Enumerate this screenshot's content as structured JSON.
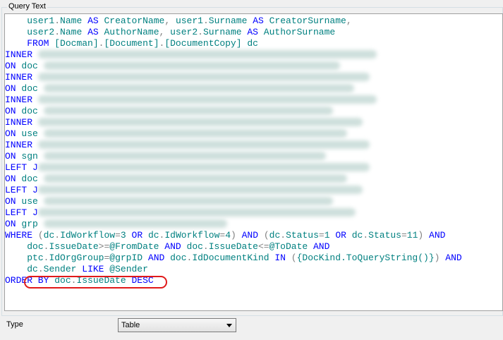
{
  "group_title": "Query Text",
  "type_label": "Type",
  "type_select": {
    "value": "Table"
  },
  "code_lines": [
    [
      {
        "t": "    "
      },
      {
        "t": "user1",
        "c": "id"
      },
      {
        "t": ".",
        "c": "op"
      },
      {
        "t": "Name",
        "c": "id"
      },
      {
        "t": " "
      },
      {
        "t": "AS",
        "c": "kw"
      },
      {
        "t": " "
      },
      {
        "t": "CreatorName",
        "c": "id"
      },
      {
        "t": ", ",
        "c": "op"
      },
      {
        "t": "user1",
        "c": "id"
      },
      {
        "t": ".",
        "c": "op"
      },
      {
        "t": "Surname",
        "c": "id"
      },
      {
        "t": " "
      },
      {
        "t": "AS",
        "c": "kw"
      },
      {
        "t": " "
      },
      {
        "t": "CreatorSurname",
        "c": "id"
      },
      {
        "t": ",",
        "c": "op"
      }
    ],
    [
      {
        "t": "    "
      },
      {
        "t": "user2",
        "c": "id"
      },
      {
        "t": ".",
        "c": "op"
      },
      {
        "t": "Name",
        "c": "id"
      },
      {
        "t": " "
      },
      {
        "t": "AS",
        "c": "kw"
      },
      {
        "t": " "
      },
      {
        "t": "AuthorName",
        "c": "id"
      },
      {
        "t": ", ",
        "c": "op"
      },
      {
        "t": "user2",
        "c": "id"
      },
      {
        "t": ".",
        "c": "op"
      },
      {
        "t": "Surname",
        "c": "id"
      },
      {
        "t": " "
      },
      {
        "t": "AS",
        "c": "kw"
      },
      {
        "t": " "
      },
      {
        "t": "AuthorSurname",
        "c": "id"
      }
    ],
    [
      {
        "t": "    "
      },
      {
        "t": "FROM",
        "c": "kw"
      },
      {
        "t": " "
      },
      {
        "t": "[Docman]",
        "c": "id"
      },
      {
        "t": ".",
        "c": "op"
      },
      {
        "t": "[Document]",
        "c": "id"
      },
      {
        "t": ".",
        "c": "op"
      },
      {
        "t": "[DocumentCopy]",
        "c": "id"
      },
      {
        "t": " "
      },
      {
        "t": "dc",
        "c": "id"
      }
    ],
    [
      {
        "t": "INNER",
        "c": "kw"
      },
      {
        "t": " "
      },
      {
        "blur": 480
      }
    ],
    [
      {
        "t": "ON",
        "c": "kw"
      },
      {
        "t": " "
      },
      {
        "t": "doc",
        "c": "id"
      },
      {
        "t": " "
      },
      {
        "blur": 420
      }
    ],
    [
      {
        "t": "INNER",
        "c": "kw"
      },
      {
        "t": " "
      },
      {
        "blur": 470
      }
    ],
    [
      {
        "t": "ON",
        "c": "kw"
      },
      {
        "t": " "
      },
      {
        "t": "doc",
        "c": "id"
      },
      {
        "t": " "
      },
      {
        "blur": 440
      }
    ],
    [
      {
        "t": "INNER",
        "c": "kw"
      },
      {
        "t": " "
      },
      {
        "blur": 480
      }
    ],
    [
      {
        "t": "ON",
        "c": "kw"
      },
      {
        "t": " "
      },
      {
        "t": "doc",
        "c": "id"
      },
      {
        "t": " "
      },
      {
        "blur": 410
      }
    ],
    [
      {
        "t": "INNER",
        "c": "kw"
      },
      {
        "t": " "
      },
      {
        "blur": 460
      }
    ],
    [
      {
        "t": "ON",
        "c": "kw"
      },
      {
        "t": " "
      },
      {
        "t": "use",
        "c": "id"
      },
      {
        "t": " "
      },
      {
        "blur": 430
      }
    ],
    [
      {
        "t": "INNER",
        "c": "kw"
      },
      {
        "t": " "
      },
      {
        "blur": 470
      }
    ],
    [
      {
        "t": "ON",
        "c": "kw"
      },
      {
        "t": " "
      },
      {
        "t": "sgn",
        "c": "id"
      },
      {
        "t": " "
      },
      {
        "blur": 400
      }
    ],
    [
      {
        "t": "LEFT J",
        "c": "kw"
      },
      {
        "blur": 470
      }
    ],
    [
      {
        "t": "ON",
        "c": "kw"
      },
      {
        "t": " "
      },
      {
        "t": "doc",
        "c": "id"
      },
      {
        "t": " "
      },
      {
        "blur": 430
      }
    ],
    [
      {
        "t": "LEFT J",
        "c": "kw"
      },
      {
        "blur": 460
      }
    ],
    [
      {
        "t": "ON",
        "c": "kw"
      },
      {
        "t": " "
      },
      {
        "t": "use",
        "c": "id"
      },
      {
        "t": " "
      },
      {
        "blur": 410
      }
    ],
    [
      {
        "t": "LEFT J",
        "c": "kw"
      },
      {
        "blur": 450
      }
    ],
    [
      {
        "t": "ON",
        "c": "kw"
      },
      {
        "t": " "
      },
      {
        "t": "grp",
        "c": "id"
      },
      {
        "t": " "
      },
      {
        "blur": 260
      }
    ],
    [
      {
        "t": "WHERE",
        "c": "kw"
      },
      {
        "t": " "
      },
      {
        "t": "(",
        "c": "op"
      },
      {
        "t": "dc",
        "c": "id"
      },
      {
        "t": ".",
        "c": "op"
      },
      {
        "t": "IdWorkflow",
        "c": "id"
      },
      {
        "t": "=",
        "c": "op"
      },
      {
        "t": "3",
        "c": "id"
      },
      {
        "t": " "
      },
      {
        "t": "OR",
        "c": "kw"
      },
      {
        "t": " "
      },
      {
        "t": "dc",
        "c": "id"
      },
      {
        "t": ".",
        "c": "op"
      },
      {
        "t": "IdWorkflow",
        "c": "id"
      },
      {
        "t": "=",
        "c": "op"
      },
      {
        "t": "4",
        "c": "id"
      },
      {
        "t": ")",
        "c": "op"
      },
      {
        "t": " "
      },
      {
        "t": "AND",
        "c": "kw"
      },
      {
        "t": " "
      },
      {
        "t": "(",
        "c": "op"
      },
      {
        "t": "dc",
        "c": "id"
      },
      {
        "t": ".",
        "c": "op"
      },
      {
        "t": "Status",
        "c": "id"
      },
      {
        "t": "=",
        "c": "op"
      },
      {
        "t": "1",
        "c": "id"
      },
      {
        "t": " "
      },
      {
        "t": "OR",
        "c": "kw"
      },
      {
        "t": " "
      },
      {
        "t": "dc",
        "c": "id"
      },
      {
        "t": ".",
        "c": "op"
      },
      {
        "t": "Status",
        "c": "id"
      },
      {
        "t": "=",
        "c": "op"
      },
      {
        "t": "11",
        "c": "id"
      },
      {
        "t": ")",
        "c": "op"
      },
      {
        "t": " "
      },
      {
        "t": "AND",
        "c": "kw"
      }
    ],
    [
      {
        "t": "    "
      },
      {
        "t": "doc",
        "c": "id"
      },
      {
        "t": ".",
        "c": "op"
      },
      {
        "t": "IssueDate",
        "c": "id"
      },
      {
        "t": ">=",
        "c": "op"
      },
      {
        "t": "@FromDate",
        "c": "id"
      },
      {
        "t": " "
      },
      {
        "t": "AND",
        "c": "kw"
      },
      {
        "t": " "
      },
      {
        "t": "doc",
        "c": "id"
      },
      {
        "t": ".",
        "c": "op"
      },
      {
        "t": "IssueDate",
        "c": "id"
      },
      {
        "t": "<=",
        "c": "op"
      },
      {
        "t": "@ToDate",
        "c": "id"
      },
      {
        "t": " "
      },
      {
        "t": "AND",
        "c": "kw"
      }
    ],
    [
      {
        "t": "    "
      },
      {
        "t": "ptc",
        "c": "id"
      },
      {
        "t": ".",
        "c": "op"
      },
      {
        "t": "IdOrgGroup",
        "c": "id"
      },
      {
        "t": "=",
        "c": "op"
      },
      {
        "t": "@grpID",
        "c": "id"
      },
      {
        "t": " "
      },
      {
        "t": "AND",
        "c": "kw"
      },
      {
        "t": " "
      },
      {
        "t": "doc",
        "c": "id"
      },
      {
        "t": ".",
        "c": "op"
      },
      {
        "t": "IdDocumentKind",
        "c": "id"
      },
      {
        "t": " "
      },
      {
        "t": "IN",
        "c": "kw"
      },
      {
        "t": " "
      },
      {
        "t": "(",
        "c": "op"
      },
      {
        "t": "{DocKind.ToQueryString()}",
        "c": "id"
      },
      {
        "t": ")",
        "c": "op"
      },
      {
        "t": " "
      },
      {
        "t": "AND",
        "c": "kw"
      }
    ],
    [
      {
        "t": "    "
      },
      {
        "t": "dc",
        "c": "id"
      },
      {
        "t": ".",
        "c": "op"
      },
      {
        "t": "Sender",
        "c": "id"
      },
      {
        "t": " "
      },
      {
        "t": "LIKE",
        "c": "kw"
      },
      {
        "t": " "
      },
      {
        "t": "@Sender",
        "c": "id"
      }
    ],
    [
      {
        "t": "ORDER BY",
        "c": "kw"
      },
      {
        "t": " "
      },
      {
        "t": "doc",
        "c": "id"
      },
      {
        "t": ".",
        "c": "op"
      },
      {
        "t": "IssueDate",
        "c": "id"
      },
      {
        "t": " "
      },
      {
        "t": "DESC",
        "c": "kw"
      }
    ]
  ],
  "colors": {
    "keyword": "#0000ff",
    "identifier": "#008080",
    "operator": "#808080",
    "highlight": "#e01a1a"
  }
}
